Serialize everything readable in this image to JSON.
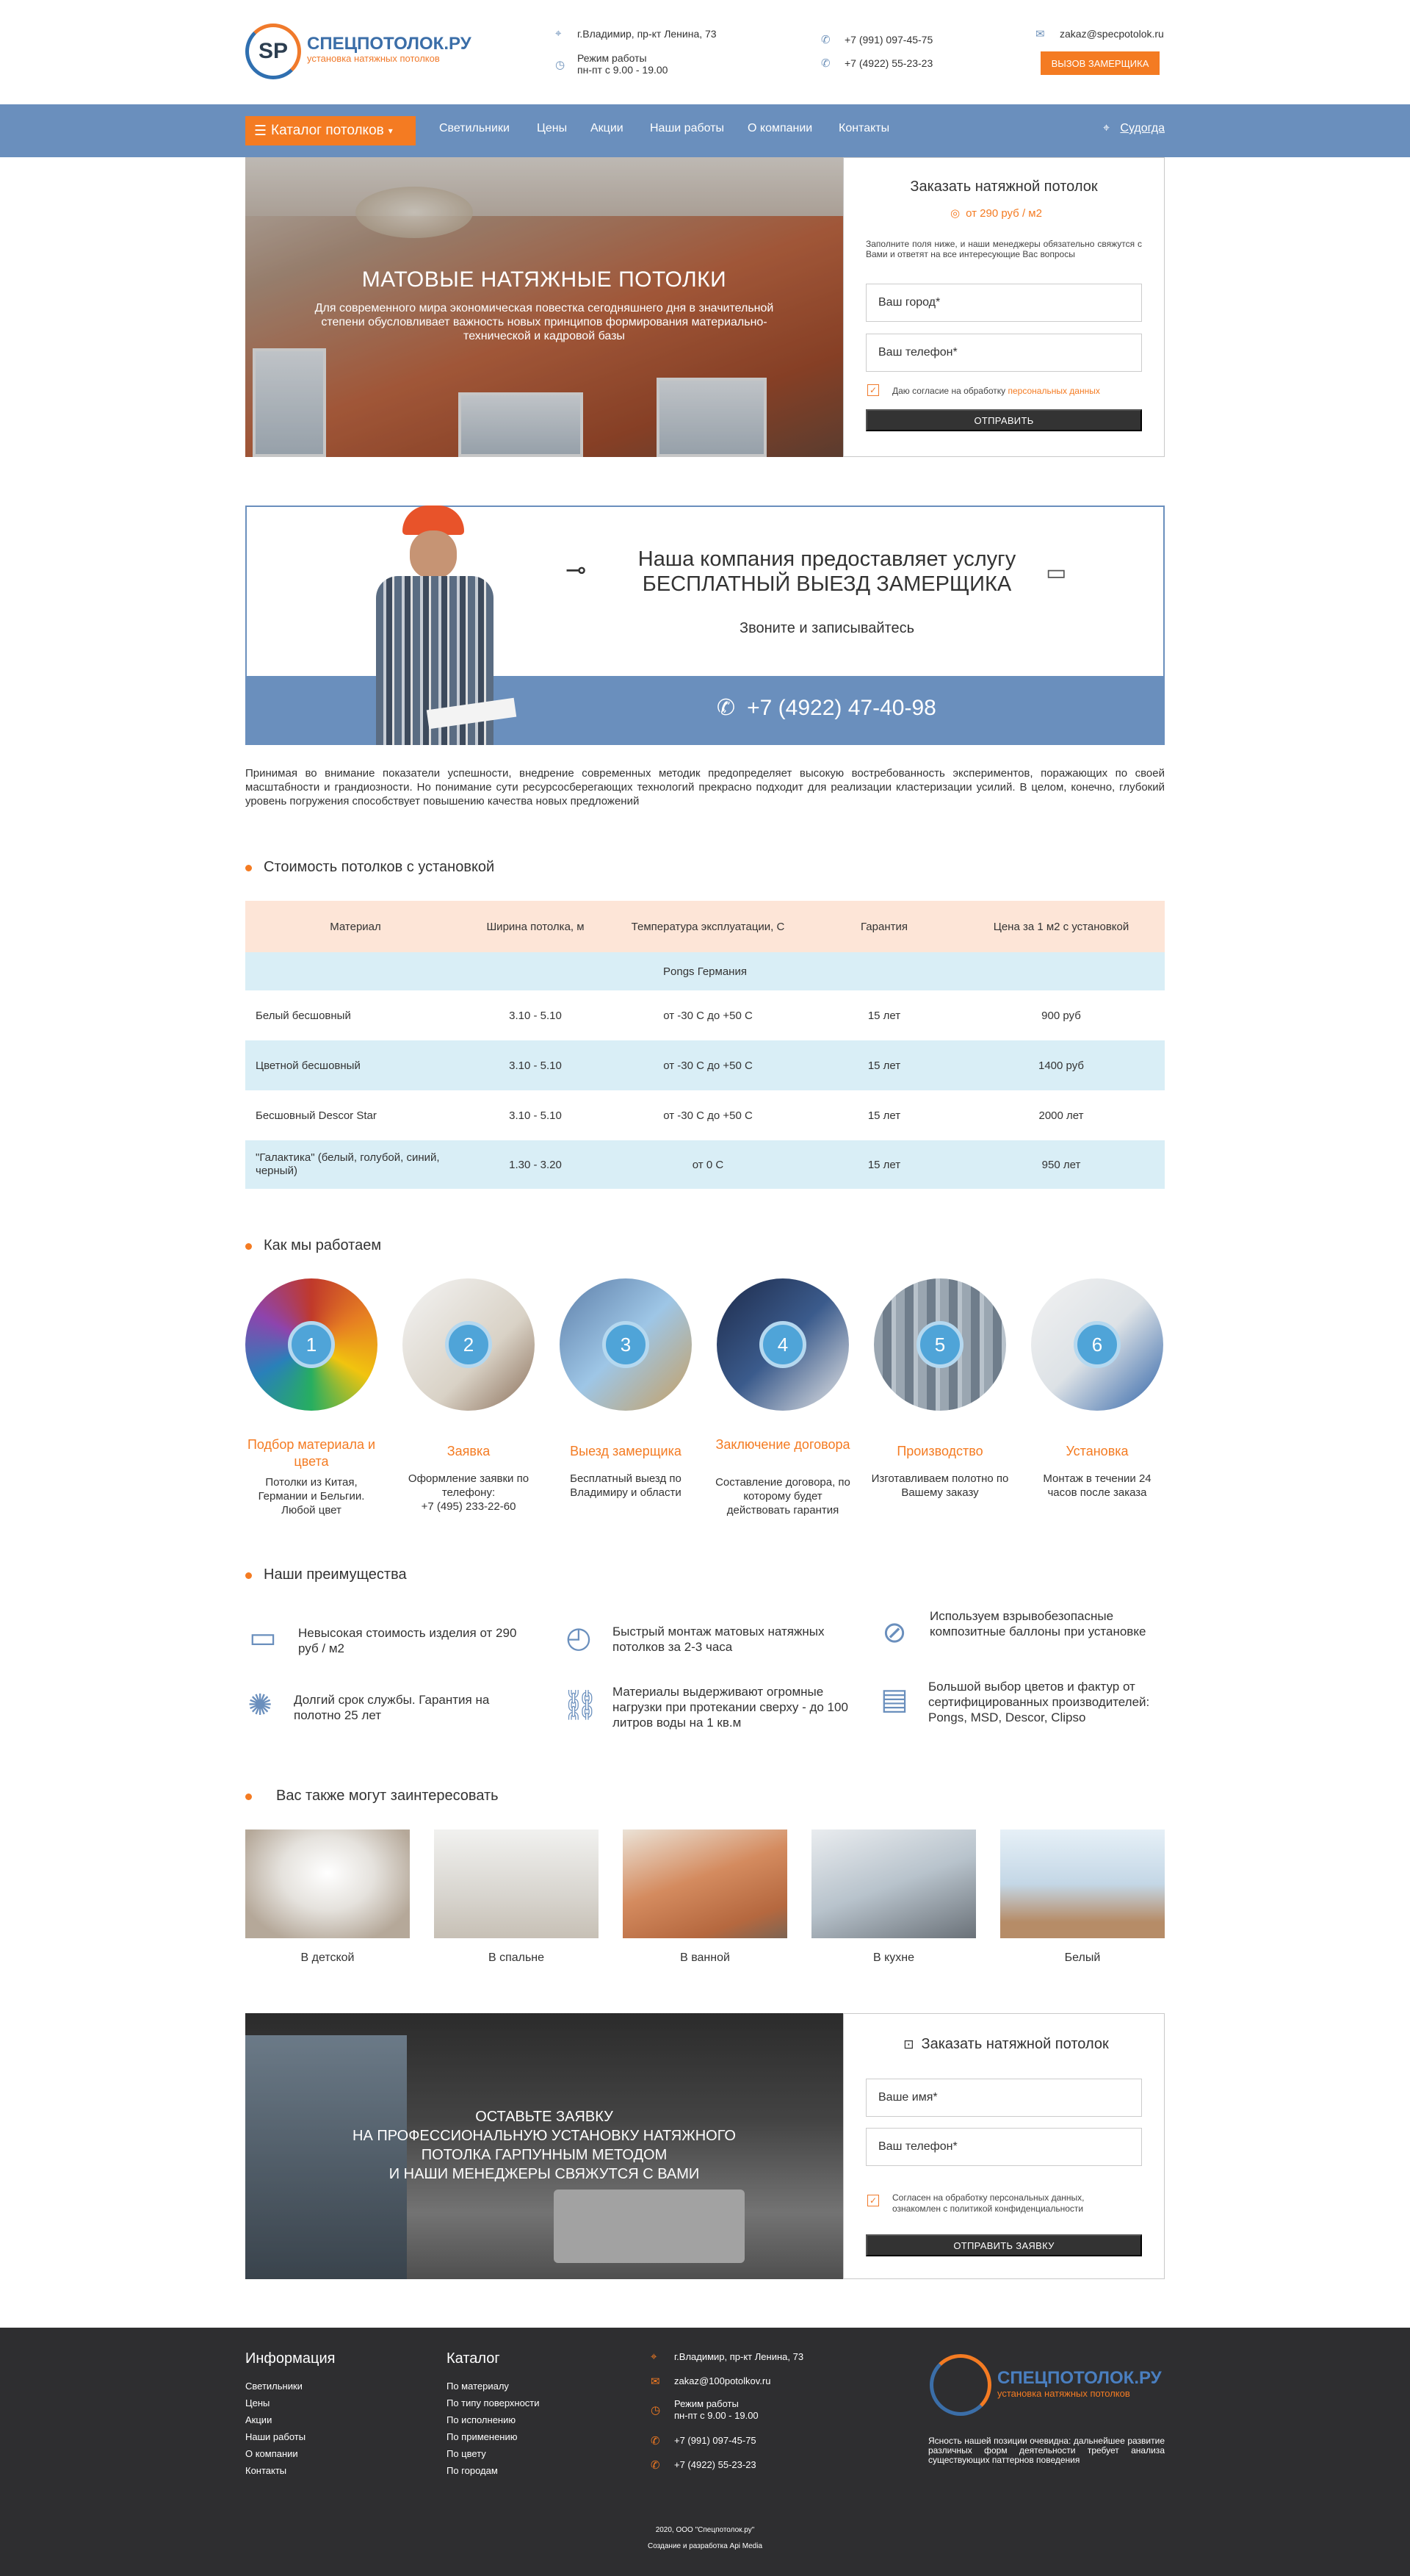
{
  "header": {
    "logo_mark": "SP",
    "logo_name": "СПЕЦПОТОЛОК.РУ",
    "logo_sub": "установка натяжных потолков",
    "address": "г.Владимир, пр-кт Ленина, 73",
    "hours_label": "Режим работы",
    "hours": "пн-пт с 9.00 - 19.00",
    "phone1": "+7 (991) 097-45-75",
    "phone2": "+7 (4922) 55-23-23",
    "email": "zakaz@specpotolok.ru",
    "callback_button": "ВЫЗОВ ЗАМЕРЩИКА"
  },
  "nav": {
    "catalog": "Каталог потолков",
    "items": [
      "Светильники",
      "Цены",
      "Акции",
      "Наши работы",
      "О компании",
      "Контакты"
    ],
    "city": "Судогда"
  },
  "hero": {
    "title": "МАТОВЫЕ НАТЯЖНЫЕ ПОТОЛКИ",
    "text": "Для современного мира экономическая повестка сегодняшнего дня в значительной степени обусловливает важность новых принципов формирования материально-технической и кадровой базы"
  },
  "order_form": {
    "title": "Заказать натяжной потолок",
    "price": "от 290 руб / м2",
    "description": "Заполните поля ниже, и наши менеджеры обязательно свяжутся с Вами и ответят на все интересующие Вас вопросы",
    "city_placeholder": "Ваш город*",
    "phone_placeholder": "Ваш телефон*",
    "consent": "Даю согласие на обработку ",
    "consent_link": "персональных данных",
    "submit": "ОТПРАВИТЬ"
  },
  "banner": {
    "line1": "Наша компания предоставляет услугу",
    "line2": "БЕСПЛАТНЫЙ ВЫЕЗД ЗАМЕРЩИКА",
    "cta": "Звоните и записывайтесь",
    "phone": "+7 (4922) 47-40-98"
  },
  "intro_text": "Принимая во внимание показатели успешности, внедрение современных методик предопределяет высокую востребованность экспериментов, поражающих по своей масштабности и грандиозности. Но понимание сути ресурсосберегающих технологий прекрасно подходит для реализации кластеризации усилий. В целом, конечно, глубокий уровень погружения способствует повышению качества новых предложений",
  "prices": {
    "title": "Стоимость потолков с установкой",
    "headers": [
      "Материал",
      "Ширина потолка, м",
      "Температура эксплуатации, С",
      "Гарантия",
      "Цена за 1 м2 с установкой"
    ],
    "group": "Pongs Германия",
    "rows": [
      [
        "Белый бесшовный",
        "3.10 - 5.10",
        "от -30 С до +50 С",
        "15 лет",
        "900 руб"
      ],
      [
        "Цветной бесшовный",
        "3.10 - 5.10",
        "от -30 С до +50 С",
        "15 лет",
        "1400 руб"
      ],
      [
        "Бесшовный Descor Star",
        "3.10 - 5.10",
        "от -30 С до +50 С",
        "15 лет",
        "2000 лет"
      ],
      [
        "\"Галактика\" (белый, голубой, синий, черный)",
        "1.30 - 3.20",
        "от 0 С",
        "15 лет",
        "950 лет"
      ]
    ]
  },
  "steps": {
    "title": "Как мы работаем",
    "items": [
      {
        "num": "1",
        "title": "Подбор материала и цвета",
        "text": "Потолки из Китая, Германии и Бельгии. Любой цвет"
      },
      {
        "num": "2",
        "title": "Заявка",
        "text": "Оформление заявки по телефону:",
        "phone": "+7 (495) 233-22-60"
      },
      {
        "num": "3",
        "title": "Выезд замерщика",
        "text": "Бесплатный выезд по Владимиру и области"
      },
      {
        "num": "4",
        "title": "Заключение договора",
        "text": "Составление договора, по которому будет действовать гарантия"
      },
      {
        "num": "5",
        "title": "Производство",
        "text": "Изготавливаем полотно по Вашему заказу"
      },
      {
        "num": "6",
        "title": "Установка",
        "text": "Монтаж в течении 24 часов после заказа"
      }
    ]
  },
  "advantages": {
    "title": "Наши преимущества",
    "items": [
      {
        "icon": "wallet-icon",
        "text": "Невысокая стоимость изделия от 290 руб / м2"
      },
      {
        "icon": "stopwatch-icon",
        "text": "Быстрый монтаж матовых натяжных потолков за 2-3 часа"
      },
      {
        "icon": "no-gas-icon",
        "text": "Используем взрывобезопасные композитные баллоны при установке"
      },
      {
        "icon": "medal-icon",
        "text": "Долгий срок службы. Гарантия на полотно 25 лет"
      },
      {
        "icon": "chain-icon",
        "text": "Материалы выдерживают огромные нагрузки при протекании сверху - до 100 литров воды на 1 кв.м"
      },
      {
        "icon": "palette-icon",
        "text": "Большой выбор цветов и фактур от сертифицированных производителей: Pongs, MSD, Descor, Clipso"
      }
    ]
  },
  "interest": {
    "title": "Вас также могут заинтересовать",
    "items": [
      "В детской",
      "В спальне",
      "В ванной",
      "В кухне",
      "Белый"
    ]
  },
  "request": {
    "text_lines": [
      "ОСТАВЬТЕ ЗАЯВКУ",
      "НА ПРОФЕССИОНАЛЬНУЮ УСТАНОВКУ НАТЯЖНОГО",
      "ПОТОЛКА ГАРПУННЫМ МЕТОДОМ",
      "И НАШИ МЕНЕДЖЕРЫ СВЯЖУТСЯ С ВАМИ"
    ],
    "form_title": "Заказать натяжной потолок",
    "name_placeholder": "Ваше имя*",
    "phone_placeholder": "Ваш телефон*",
    "consent": "Согласен на обработку персональных данных, ознакомлен с политикой конфиденциальности",
    "submit": "ОТПРАВИТЬ ЗАЯВКУ"
  },
  "footer": {
    "info_title": "Информация",
    "info_links": [
      "Светильники",
      "Цены",
      "Акции",
      "Наши работы",
      "О компании",
      "Контакты"
    ],
    "catalog_title": "Каталог",
    "catalog_links": [
      "По материалу",
      "По типу поверхности",
      "По исполнению",
      "По применению",
      "По цвету",
      "По городам"
    ],
    "address": "г.Владимир, пр-кт Ленина, 73",
    "email": "zakaz@100potolkov.ru",
    "hours_label": "Режим работы",
    "hours": "пн-пт с 9.00 - 19.00",
    "phone1": "+7 (991) 097-45-75",
    "phone2": "+7 (4922) 55-23-23",
    "logo_name": "СПЕЦПОТОЛОК.РУ",
    "logo_sub": "установка натяжных потолков",
    "about": "Ясность нашей позиции очевидна: дальнейшее развитие различных форм деятельности требует анализа существующих паттернов поведения",
    "copyright": "2020, ООО \"Спецпотолок.ру\"",
    "developer": "Создание и разработка Api Media"
  },
  "colors": {
    "accent": "#f47b22",
    "nav": "#6a8fbd",
    "table_head": "#fde5d7",
    "table_alt": "#d9eef6",
    "footer": "#2e2e30"
  }
}
